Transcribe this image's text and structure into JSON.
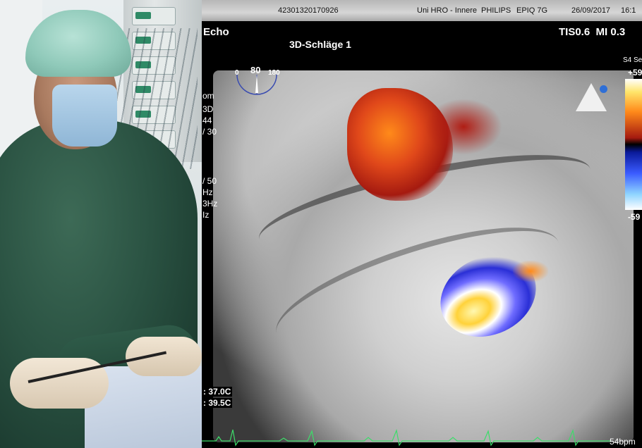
{
  "top_bar": {
    "patient_id": "42301320170926",
    "institution": "Uni HRO - Innere",
    "vendor": "PHILIPS",
    "model": "EPIQ 7G",
    "date": "26/09/2017",
    "time": "16:1"
  },
  "mode_label": "Echo",
  "image_title": "3D-Schläge 1",
  "tis": "TIS0.6",
  "mi": "MI 0.3",
  "probe_label": "S4 Se",
  "angle_dial": {
    "min": "0",
    "value": "80",
    "max": "180"
  },
  "color_scale": {
    "high": "+59",
    "low": "-59"
  },
  "side_params": [
    "om",
    "3D",
    "44",
    "/ 30",
    "",
    "",
    "",
    "/ 50",
    "Hz",
    "3Hz",
    "Iz"
  ],
  "temperatures": [
    "37.0C",
    "39.5C"
  ],
  "heart_rate": "54bpm",
  "colors": {
    "ecg": "#3ddc6a",
    "topbar": "#c8c8c8",
    "text": "#ffffff"
  }
}
